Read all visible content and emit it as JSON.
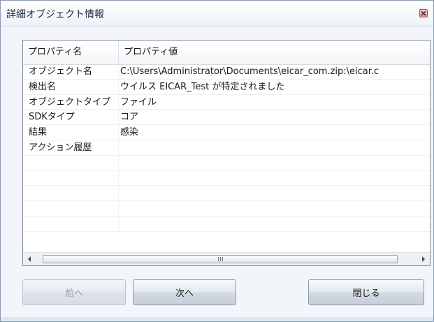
{
  "window": {
    "title": "詳細オブジェクト情報"
  },
  "table": {
    "columns": [
      "プロパティ名",
      "プロパティ値"
    ],
    "rows": [
      {
        "name": "オブジェクト名",
        "value": "C:\\Users\\Administrator\\Documents\\eicar_com.zip:\\eicar.c"
      },
      {
        "name": "検出名",
        "value": "ウイルス EICAR_Test が特定されました"
      },
      {
        "name": "オブジェクトタイプ",
        "value": "ファイル"
      },
      {
        "name": "SDKタイプ",
        "value": "コア"
      },
      {
        "name": "結果",
        "value": "感染"
      },
      {
        "name": "アクション履歴",
        "value": ""
      }
    ]
  },
  "buttons": {
    "prev": "前へ",
    "next": "次へ",
    "close": "閉じる"
  },
  "icons": {
    "close": "close-icon",
    "scroll_left": "arrow-left-icon",
    "scroll_right": "arrow-right-icon",
    "grip": "scroll-grip-icon"
  },
  "colors": {
    "close_button": "#dc8d95",
    "title_text": "#1e2a44",
    "disabled_text": "#9aa0a6"
  }
}
